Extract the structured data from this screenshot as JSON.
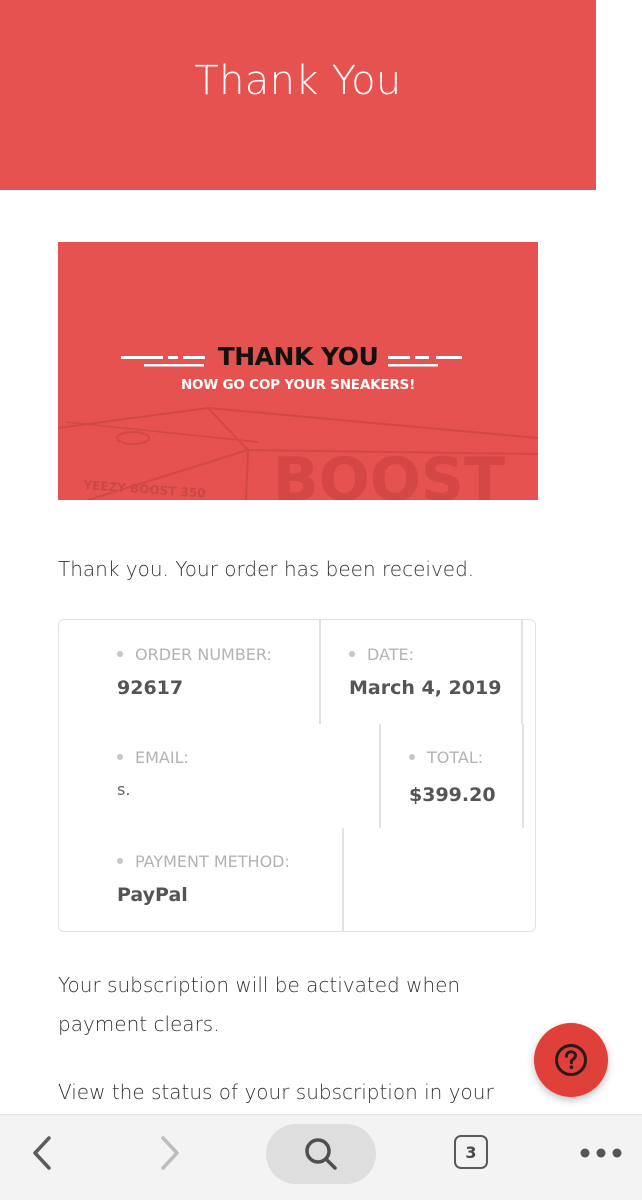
{
  "hero": {
    "title": "Thank You"
  },
  "banner": {
    "title": "THANK YOU",
    "subtitle": "NOW GO COP YOUR SNEAKERS!",
    "box_text": "YEEZY BOOST 350",
    "box_big_text": "BOOST"
  },
  "message": "Thank you. Your order has been received.",
  "order": {
    "number_label": "ORDER NUMBER:",
    "number_value": "92617",
    "date_label": "DATE:",
    "date_value": "March 4, 2019",
    "email_label": "EMAIL:",
    "email_value": "s.",
    "total_label": "TOTAL:",
    "total_value": "$399.20",
    "payment_label": "PAYMENT METHOD:",
    "payment_value": "PayPal"
  },
  "subscription_note": {
    "line1": "Your subscription will be activated when",
    "line2": "payment clears."
  },
  "status_note": "View the status of your subscription in your",
  "help_button": {
    "icon": "question-icon"
  },
  "browser_bar": {
    "tabs_count": "3"
  },
  "colors": {
    "accent": "#e5524f",
    "fab": "#e0403a"
  }
}
